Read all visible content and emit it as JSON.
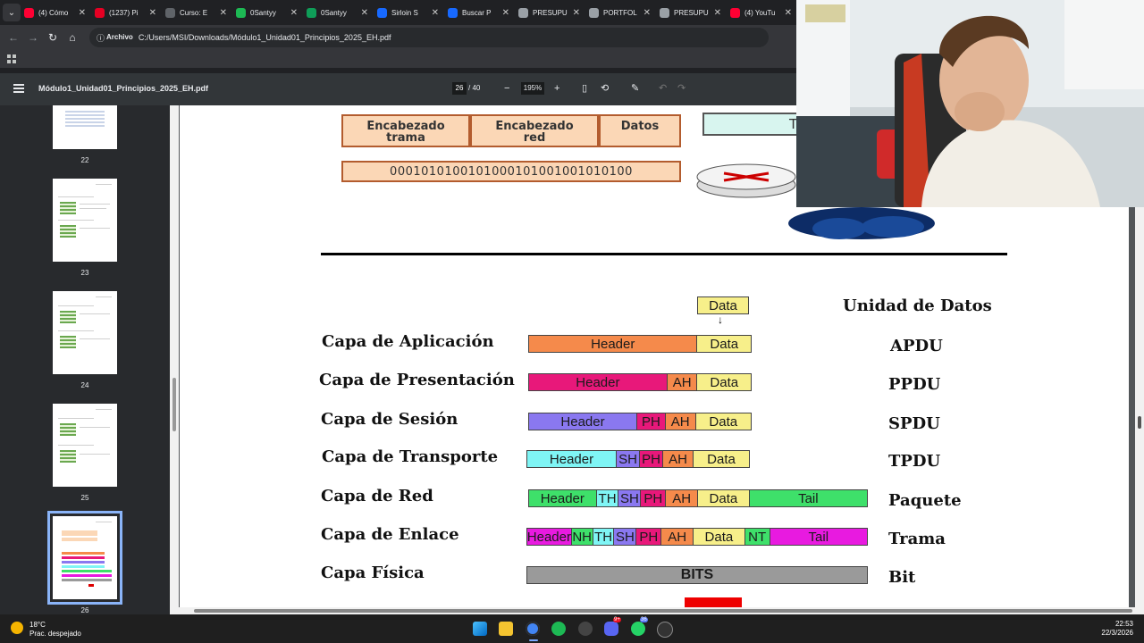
{
  "browser": {
    "tabs": [
      {
        "title": "(4) Cómo",
        "color": "#ff0033"
      },
      {
        "title": "(1237) Pi",
        "color": "#e60023"
      },
      {
        "title": "Curso: E",
        "color": "#5f6368"
      },
      {
        "title": "0Santyy",
        "color": "#1db954"
      },
      {
        "title": "0Santyy",
        "color": "#0f9d58"
      },
      {
        "title": "Sirloin S",
        "color": "#1769ff"
      },
      {
        "title": "Buscar P",
        "color": "#1769ff"
      },
      {
        "title": "PRESUPU",
        "color": "#9aa0a6"
      },
      {
        "title": "PORTFOL",
        "color": "#9aa0a6"
      },
      {
        "title": "PRESUPU",
        "color": "#9aa0a6"
      },
      {
        "title": "(4) YouTu",
        "color": "#ff0033"
      }
    ],
    "address_chip": "Archivo",
    "url": "C:/Users/MSI/Downloads/Módulo1_Unidad01_Principios_2025_EH.pdf"
  },
  "pdf_toolbar": {
    "title": "Módulo1_Unidad01_Principios_2025_EH.pdf",
    "page_current": "26",
    "page_total": "/ 40",
    "zoom": "195%",
    "minus": "−",
    "plus": "+"
  },
  "thumbnails": [
    {
      "num": "22"
    },
    {
      "num": "23"
    },
    {
      "num": "24"
    },
    {
      "num": "25"
    },
    {
      "num": "26",
      "selected": true
    }
  ],
  "frame_diagram": {
    "header_trama": "Encabezado trama",
    "header_red": "Encabezado red",
    "datos": "Datos",
    "bits": "0001010100101000101001001010100",
    "trama_label": "Tram"
  },
  "osi": {
    "top_data": "Data",
    "unit_title": "Unidad de Datos",
    "layers": [
      {
        "name": "Capa de Aplicación",
        "unit": "APDU",
        "segments": [
          {
            "t": "Header",
            "c": "#f58a4b"
          },
          {
            "t": "Data",
            "c": "#f7ef8a"
          }
        ]
      },
      {
        "name": "Capa de Presentación",
        "unit": "PPDU",
        "segments": [
          {
            "t": "Header",
            "c": "#e8187a"
          },
          {
            "t": "AH",
            "c": "#f58a4b"
          },
          {
            "t": "Data",
            "c": "#f7ef8a"
          }
        ]
      },
      {
        "name": "Capa de Sesión",
        "unit": "SPDU",
        "segments": [
          {
            "t": "Header",
            "c": "#8a78f0"
          },
          {
            "t": "PH",
            "c": "#e8187a"
          },
          {
            "t": "AH",
            "c": "#f58a4b"
          },
          {
            "t": "Data",
            "c": "#f7ef8a"
          }
        ]
      },
      {
        "name": "Capa de Transporte",
        "unit": "TPDU",
        "segments": [
          {
            "t": "Header",
            "c": "#7ff5f5"
          },
          {
            "t": "SH",
            "c": "#8a78f0"
          },
          {
            "t": "PH",
            "c": "#e8187a"
          },
          {
            "t": "AH",
            "c": "#f58a4b"
          },
          {
            "t": "Data",
            "c": "#f7ef8a"
          }
        ]
      },
      {
        "name": "Capa de Red",
        "unit": "Paquete",
        "segments": [
          {
            "t": "Header",
            "c": "#3ee06a"
          },
          {
            "t": "TH",
            "c": "#7ff5f5"
          },
          {
            "t": "SH",
            "c": "#8a78f0"
          },
          {
            "t": "PH",
            "c": "#e8187a"
          },
          {
            "t": "AH",
            "c": "#f58a4b"
          },
          {
            "t": "Data",
            "c": "#f7ef8a"
          },
          {
            "t": "Tail",
            "c": "#3ee06a"
          }
        ]
      },
      {
        "name": "Capa  de Enlace",
        "unit": "Trama",
        "segments": [
          {
            "t": "Header",
            "c": "#e81ae0"
          },
          {
            "t": "NH",
            "c": "#3ee06a"
          },
          {
            "t": "TH",
            "c": "#7ff5f5"
          },
          {
            "t": "SH",
            "c": "#8a78f0"
          },
          {
            "t": "PH",
            "c": "#e8187a"
          },
          {
            "t": "AH",
            "c": "#f58a4b"
          },
          {
            "t": "Data",
            "c": "#f7ef8a"
          },
          {
            "t": "NT",
            "c": "#3ee06a"
          },
          {
            "t": "Tail",
            "c": "#e81ae0"
          }
        ]
      },
      {
        "name": "Capa Física",
        "unit": "Bit",
        "segments": [
          {
            "t": "BITS",
            "c": "#9a9a9a"
          }
        ]
      }
    ]
  },
  "taskbar": {
    "temp": "18°C",
    "weather": "Prac. despejado",
    "time": "22:53",
    "date": "22/3/2026",
    "badge_discord": "9+",
    "badge_whatsapp": "36"
  }
}
